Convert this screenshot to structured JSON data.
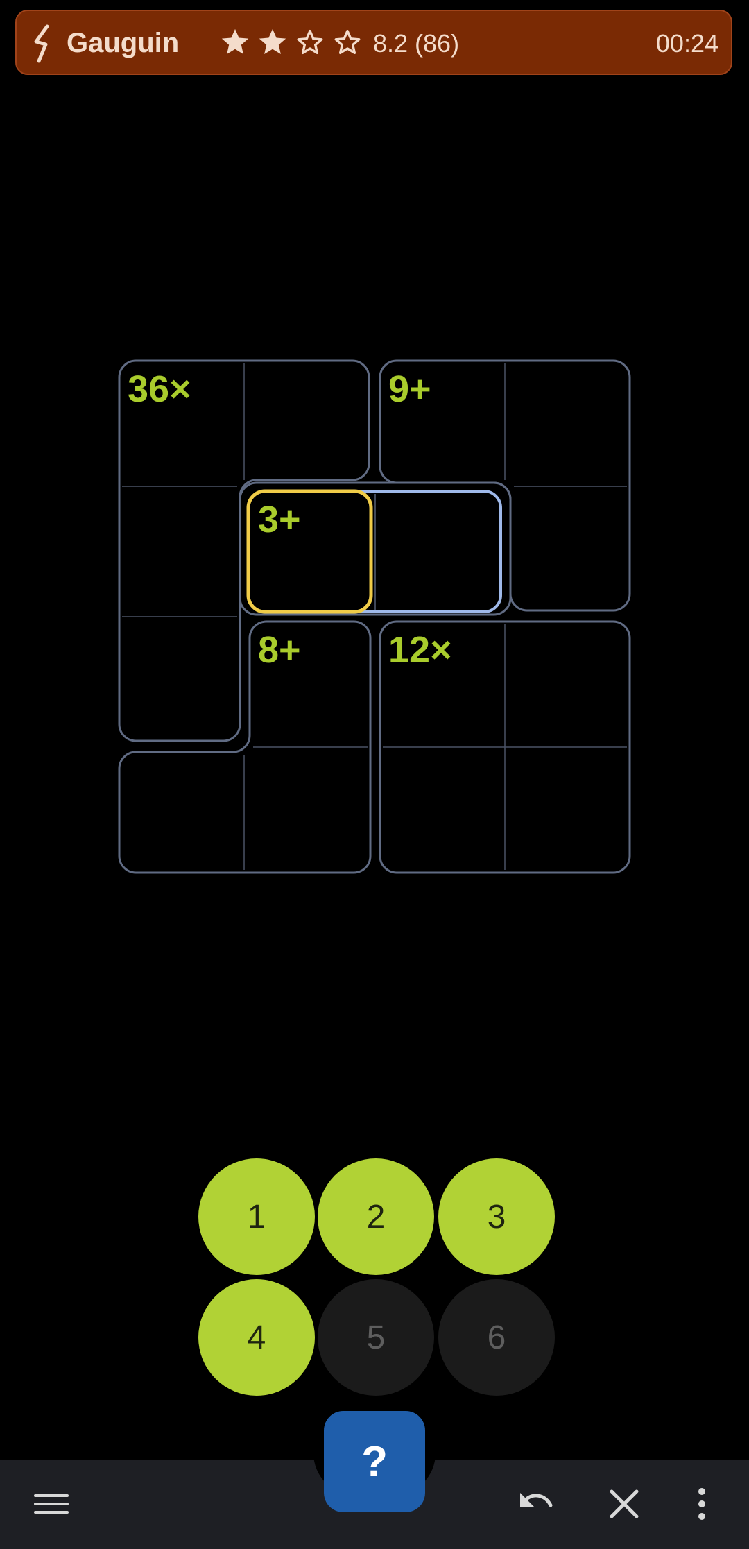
{
  "title": {
    "app_name": "Gauguin",
    "stars_filled": 2,
    "stars_total": 4,
    "rating": "8.2 (86)",
    "timer": "00:24"
  },
  "board": {
    "clues": [
      "36×",
      "9+",
      "3+",
      "8+",
      "12×"
    ]
  },
  "keypad": {
    "keys": [
      {
        "label": "1",
        "enabled": true
      },
      {
        "label": "2",
        "enabled": true
      },
      {
        "label": "3",
        "enabled": true
      },
      {
        "label": "4",
        "enabled": true
      },
      {
        "label": "5",
        "enabled": false
      },
      {
        "label": "6",
        "enabled": false
      }
    ]
  },
  "fab": {
    "label": "?"
  },
  "colors": {
    "header": "#7a2a04",
    "clue": "#a9cc2c",
    "cage": "#606b83",
    "selected": "#f0cc48",
    "highlight": "#9fb9ea",
    "key_on": "#b1d235",
    "fab": "#1f5eab"
  },
  "icons": [
    "menu-icon",
    "undo-icon",
    "close-icon",
    "more-vert-icon"
  ]
}
